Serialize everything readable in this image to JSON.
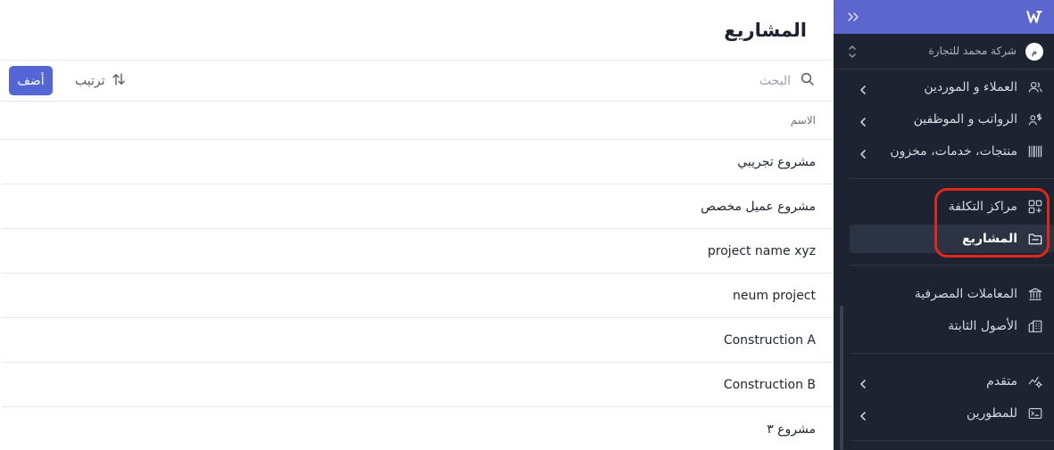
{
  "page": {
    "title": "المشاريع",
    "add_label": "أضف",
    "sort_label": "ترتيب",
    "search_placeholder": "البحث",
    "column_name": "الاسم",
    "rows": [
      "مشروع تجريبي",
      "مشروع عميل مخصص",
      "project name xyz",
      "neum project",
      "Construction A",
      "Construction B",
      "مشروع ٣"
    ]
  },
  "sidebar": {
    "company_name": "شركة محمد للتجارة",
    "company_initial": "م",
    "items": [
      {
        "label": "العملاء و الموردين",
        "icon": "users-icon",
        "has_children": true
      },
      {
        "label": "الرواتب و الموظفين",
        "icon": "payroll-icon",
        "has_children": true
      },
      {
        "label": "منتجات، خدمات، مخزون",
        "icon": "barcode-icon",
        "has_children": true
      },
      {
        "label": "مراكز التكلفة",
        "icon": "grid-plus-icon",
        "has_children": false
      },
      {
        "label": "المشاريع",
        "icon": "folder-icon",
        "has_children": false,
        "active": true
      },
      {
        "label": "المعاملات المصرفية",
        "icon": "bank-icon",
        "has_children": false
      },
      {
        "label": "الأصول الثابتة",
        "icon": "building-icon",
        "has_children": false
      },
      {
        "label": "متقدم",
        "icon": "advanced-icon",
        "has_children": true
      },
      {
        "label": "للمطورين",
        "icon": "terminal-icon",
        "has_children": true
      }
    ]
  },
  "colors": {
    "sidebar_bg": "#1d2330",
    "sidebar_header": "#5b66cf",
    "accent": "#5465d6",
    "highlight": "#e0271c"
  }
}
